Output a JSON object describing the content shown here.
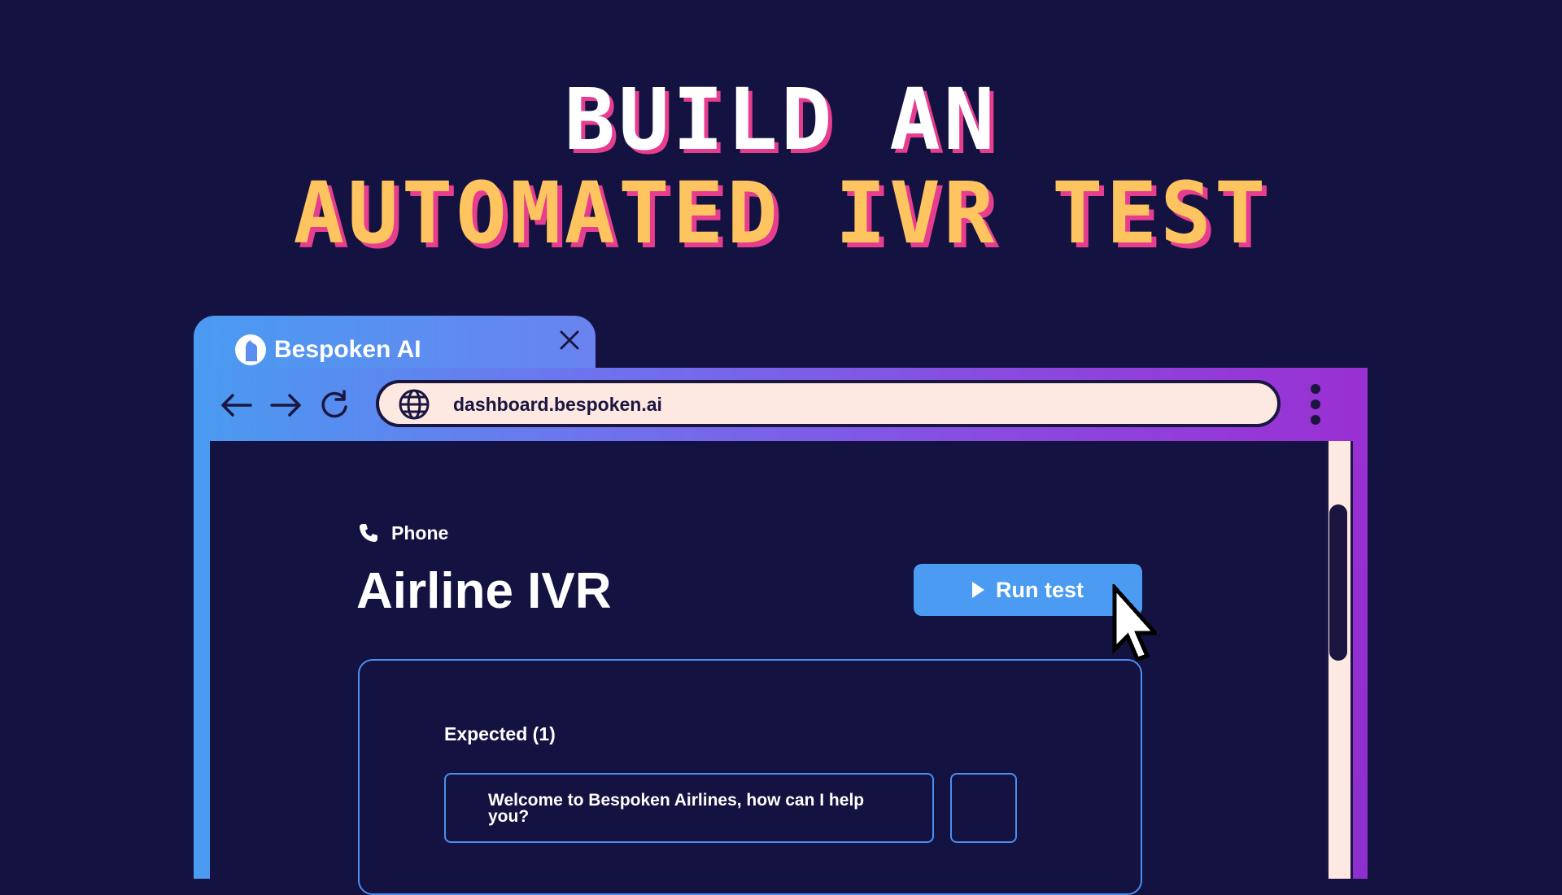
{
  "headline": {
    "line1": "BUILD AN",
    "line2": "AUTOMATED IVR TEST"
  },
  "browser": {
    "tab_title": "Bespoken AI",
    "url": "dashboard.bespoken.ai"
  },
  "page": {
    "breadcrumb_label": "Phone",
    "title": "Airline IVR",
    "run_button_label": "Run test",
    "expected_label": "Expected (1)",
    "expected_value": "Welcome to Bespoken Airlines, how can I help you?"
  },
  "colors": {
    "background": "#131241",
    "accent_blue": "#4a9bf1",
    "accent_purple": "#9a2fd2",
    "headline_yellow": "#fec45f",
    "headline_shadow": "#e63d8e"
  }
}
